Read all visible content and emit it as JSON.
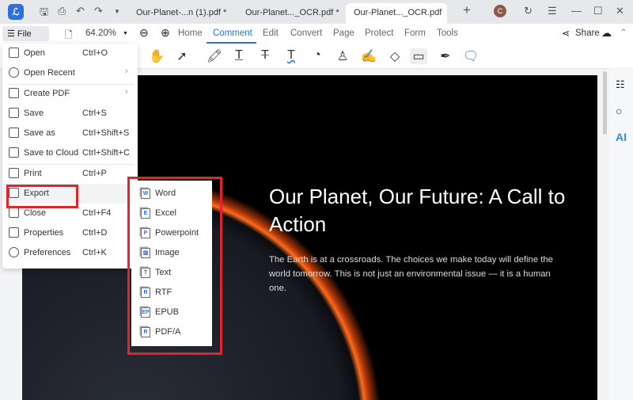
{
  "titlebar": {
    "tabs": [
      {
        "label": "Our-Planet-...n (1).pdf *"
      },
      {
        "label": "Our-Planet..._OCR.pdf *"
      },
      {
        "label": "Our-Planet..._OCR.pdf *"
      }
    ],
    "avatar": "C"
  },
  "menubar": {
    "file": "File",
    "zoom": "64.20%",
    "tabs": [
      "Home",
      "Comment",
      "Edit",
      "Convert",
      "Page",
      "Protect",
      "Form",
      "Tools"
    ],
    "share": "Share"
  },
  "file_menu": [
    {
      "label": "Open",
      "shortcut": "Ctrl+O"
    },
    {
      "label": "Open Recent",
      "shortcut": ""
    },
    {
      "label": "Create PDF",
      "shortcut": ""
    },
    {
      "label": "Save",
      "shortcut": "Ctrl+S"
    },
    {
      "label": "Save as",
      "shortcut": "Ctrl+Shift+S"
    },
    {
      "label": "Save to Cloud",
      "shortcut": "Ctrl+Shift+C"
    },
    {
      "label": "Print",
      "shortcut": "Ctrl+P"
    },
    {
      "label": "Export",
      "shortcut": ""
    },
    {
      "label": "Close",
      "shortcut": "Ctrl+F4"
    },
    {
      "label": "Properties",
      "shortcut": "Ctrl+D"
    },
    {
      "label": "Preferences",
      "shortcut": "Ctrl+K"
    }
  ],
  "export_menu": [
    {
      "label": "Word",
      "icon": "W"
    },
    {
      "label": "Excel",
      "icon": "E"
    },
    {
      "label": "Powerpoint",
      "icon": "P"
    },
    {
      "label": "Image",
      "icon": "▨"
    },
    {
      "label": "Text",
      "icon": "T"
    },
    {
      "label": "RTF",
      "icon": "R"
    },
    {
      "label": "EPUB",
      "icon": "EP"
    },
    {
      "label": "PDF/A",
      "icon": "R"
    }
  ],
  "document": {
    "title": "Our Planet, Our Future: A Call to Action",
    "body": "The Earth is at a crossroads. The choices we make today will define the world tomorrow. This is not just an environmental issue — it is a human one."
  },
  "rightpanel": {
    "ai": "AI"
  },
  "colors": {
    "accent": "#2f6fe0",
    "highlight": "#e0262c"
  }
}
